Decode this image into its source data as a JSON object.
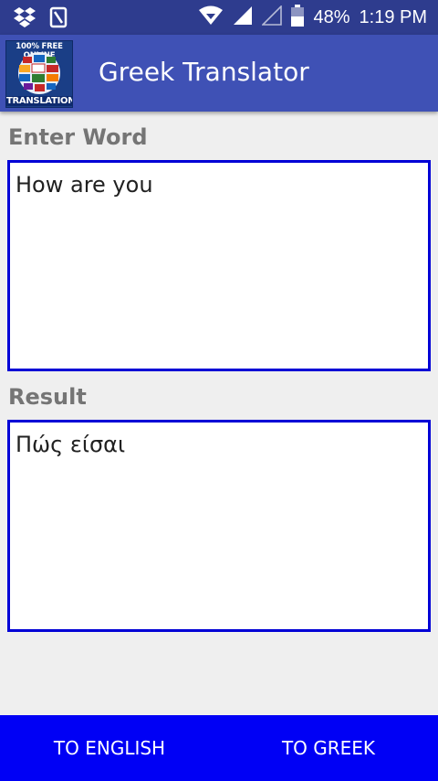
{
  "status_bar": {
    "battery_percent": "48%",
    "time": "1:19 PM",
    "icons": [
      "dropbox-icon",
      "nfc-icon",
      "wifi-icon",
      "signal-icon",
      "signal-empty-icon",
      "battery-icon"
    ]
  },
  "app_bar": {
    "logo_top_text": "100% FREE ONLINE",
    "logo_bottom_text": "TRANSLATION",
    "title": "Greek Translator"
  },
  "input_section": {
    "label": "Enter Word",
    "value": "How are you"
  },
  "result_section": {
    "label": "Result",
    "value": "Πώς είσαι"
  },
  "buttons": {
    "to_english": "TO ENGLISH",
    "to_greek": "TO GREEK"
  },
  "colors": {
    "status_bar": "#2e3c8e",
    "app_bar": "#3f51b5",
    "box_border": "#0000d6",
    "bottom_bar": "#0000f5"
  }
}
